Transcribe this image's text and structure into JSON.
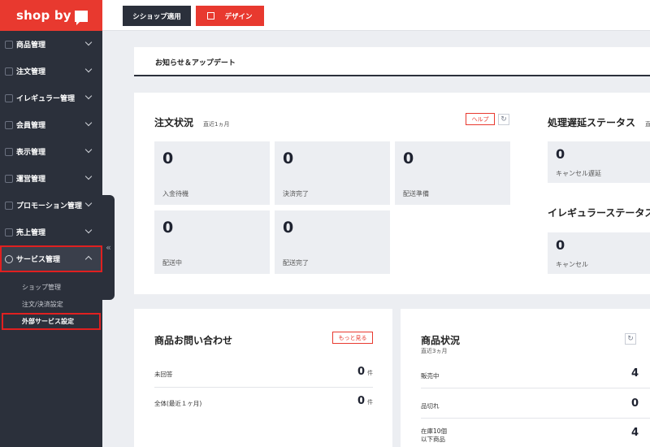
{
  "logo": {
    "text": "shop by"
  },
  "topbar": {
    "apply_label": "シショップ適用",
    "design_label": "デザイン"
  },
  "sidebar": {
    "items": [
      {
        "label": "商品管理"
      },
      {
        "label": "注文管理"
      },
      {
        "label": "イレギュラー管理"
      },
      {
        "label": "会員管理"
      },
      {
        "label": "表示管理"
      },
      {
        "label": "運営管理"
      },
      {
        "label": "プロモーション管理"
      },
      {
        "label": "売上管理"
      },
      {
        "label": "サービス管理"
      }
    ],
    "sub_items": [
      {
        "label": "ショップ管理"
      },
      {
        "label": "注文/決済設定"
      },
      {
        "label": "外部サービス設定"
      }
    ],
    "collapse_glyph": "«"
  },
  "notice": {
    "title": "お知らせ＆アップデート"
  },
  "order_status": {
    "title": "注文状況",
    "period": "直近1ヵ月",
    "help_label": "ヘルプ",
    "cards": [
      {
        "value": "0",
        "label": "入金待機"
      },
      {
        "value": "0",
        "label": "決済完了"
      },
      {
        "value": "0",
        "label": "配送準備"
      },
      {
        "value": "0",
        "label": "配送中"
      },
      {
        "value": "0",
        "label": "配送完了"
      }
    ]
  },
  "delay_status": {
    "title": "処理遅延ステータス",
    "suffix": "直",
    "card": {
      "value": "0",
      "label": "キャンセル遅延"
    }
  },
  "irregular_status": {
    "title": "イレギュラーステータス",
    "card": {
      "value": "0",
      "label": "キャンセル"
    }
  },
  "inquiry": {
    "title": "商品お問い合わせ",
    "more_label": "もっと見る",
    "rows": [
      {
        "label": "未回答",
        "value": "0",
        "unit": "件"
      },
      {
        "label": "全体(最近１ヶ月)",
        "value": "0",
        "unit": "件"
      }
    ]
  },
  "product_status": {
    "title": "商品状況",
    "period": "直近3ヵ月",
    "rows": [
      {
        "label": "販売中",
        "value": "4"
      },
      {
        "label": "品切れ",
        "value": "0"
      },
      {
        "label": "在庫10個",
        "label2": "以下商品",
        "value": "4"
      }
    ]
  },
  "refresh_glyph": "↻"
}
